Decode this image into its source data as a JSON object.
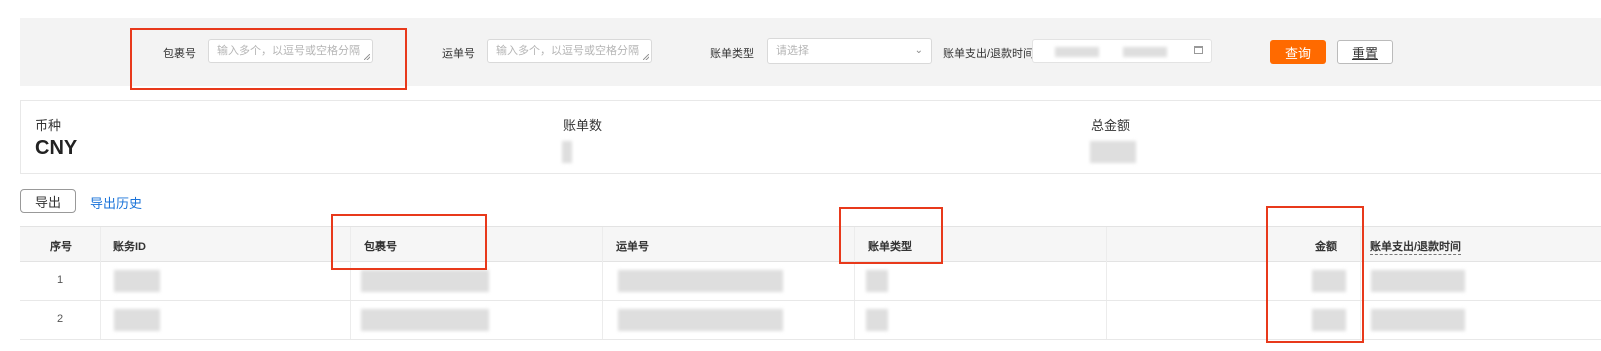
{
  "filters": {
    "parcel_no_label": "包裹号",
    "parcel_no_placeholder": "输入多个，以逗号或空格分隔",
    "waybill_no_label": "运单号",
    "waybill_no_placeholder": "输入多个，以逗号或空格分隔",
    "bill_type_label": "账单类型",
    "bill_type_placeholder": "请选择",
    "time_label": "账单支出/退款时间",
    "query_button": "查询",
    "reset_button": "重置"
  },
  "summary": {
    "currency_label": "币种",
    "currency_value": "CNY",
    "bill_count_label": "账单数",
    "total_amount_label": "总金额"
  },
  "actions": {
    "export_button": "导出",
    "export_history_link": "导出历史"
  },
  "table": {
    "columns": [
      "序号",
      "账务ID",
      "包裹号",
      "运单号",
      "账单类型",
      "金额",
      "账单支出/退款时间"
    ],
    "rows": [
      {
        "index": "1"
      },
      {
        "index": "2"
      }
    ]
  },
  "colors": {
    "primary": "#ff6a00",
    "link": "#1a73d9",
    "highlight": "#e8391b"
  }
}
